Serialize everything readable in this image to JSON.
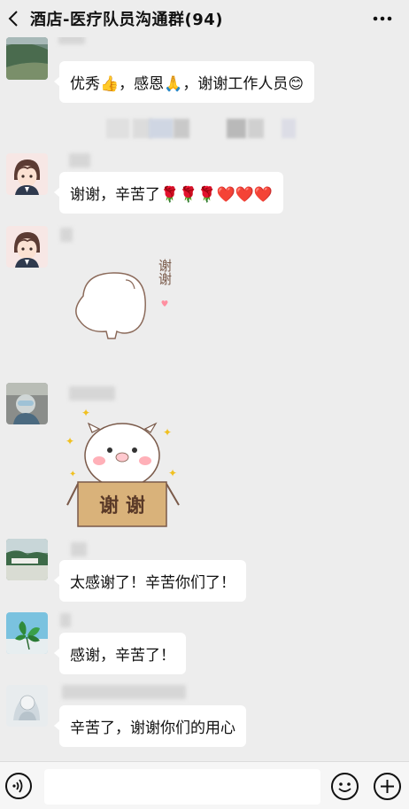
{
  "header": {
    "title": "酒店-医疗队员沟通群(94)"
  },
  "messages": [
    {
      "text": "优秀👍，感恩🙏，谢谢工作人员😊"
    },
    {
      "text": "谢谢，辛苦了🌹🌹🌹❤️❤️❤️"
    },
    {
      "sticker_text": "谢谢"
    },
    {
      "sticker_text": "谢 谢"
    },
    {
      "text": "太感谢了！辛苦你们了！"
    },
    {
      "text": "感谢，辛苦了！"
    },
    {
      "text": "辛苦了，谢谢你们的用心"
    }
  ],
  "colors": {
    "background": "#ededed",
    "bubble": "#ffffff",
    "heart": "#ff6b4a",
    "rose": "#d9283c",
    "sticker_box": "#d9b27a"
  }
}
